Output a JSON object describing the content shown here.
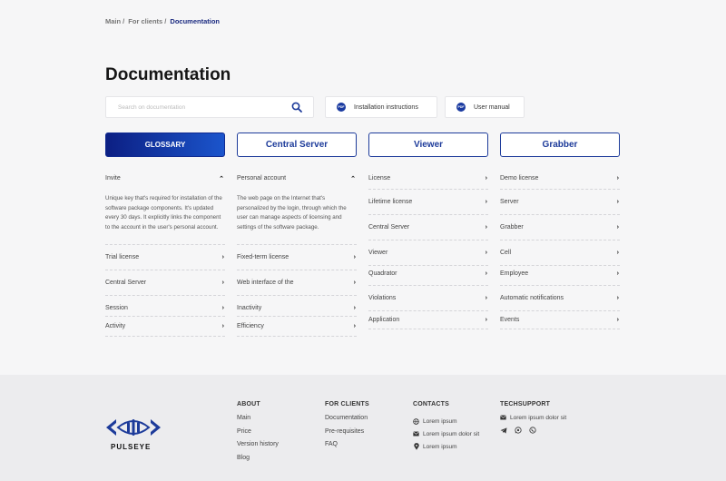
{
  "breadcrumb": {
    "items": [
      "Main",
      "For clients"
    ],
    "separator": "/",
    "current": "Documentation"
  },
  "page_title": "Documentation",
  "search": {
    "placeholder": "Search on documentation",
    "icon": "search-icon"
  },
  "doc_buttons": [
    {
      "badge": "PDF",
      "label": "Installation instructions"
    },
    {
      "badge": "PDF",
      "label": "User manual"
    }
  ],
  "tabs": [
    {
      "label": "GLOSSARY",
      "active": true
    },
    {
      "label": "Central Server",
      "active": false
    },
    {
      "label": "Viewer",
      "active": false
    },
    {
      "label": "Grabber",
      "active": false
    }
  ],
  "columns": [
    {
      "expanded": {
        "term": "Invite",
        "description": "Unique key that's required for installation of the software package components. It's updated every 30 days. It explicitly links the component to the account in the user's personal account."
      },
      "items": [
        "Trial license",
        "Central Server",
        "Session",
        "Activity"
      ]
    },
    {
      "expanded": {
        "term": "Personal account",
        "description": "The web page on the Internet that's personalized by the login, through which the user can manage aspects of licensing and settings of the software package."
      },
      "items": [
        "Fixed-term license",
        "Web interface of the",
        "Inactivity",
        "Efficiency"
      ]
    },
    {
      "items": [
        "License",
        "Lifetime license",
        "Central Server",
        "Viewer",
        "Quadrator",
        "Violations",
        "Application"
      ]
    },
    {
      "items": [
        "Demo license",
        "Server",
        "Grabber",
        "Cell",
        "Employee",
        "Automatic notifications",
        "Events"
      ]
    }
  ],
  "footer": {
    "logo_text": "PULSEYE",
    "about": {
      "title": "ABOUT",
      "links": [
        "Main",
        "Price",
        "Version history",
        "Blog"
      ]
    },
    "for_clients": {
      "title": "FOR CLIENTS",
      "links": [
        "Documentation",
        "Pre-requisites",
        "FAQ"
      ]
    },
    "contacts": {
      "title": "CONTACTS",
      "rows": [
        {
          "icon": "globe-icon",
          "text": "Lorem ipsum"
        },
        {
          "icon": "mail-icon",
          "text": "Lorem ipsum dolor sit"
        },
        {
          "icon": "location-pin-icon",
          "text": "Lorem ipsum"
        }
      ]
    },
    "techsupport": {
      "title": "TECHSUPPORT",
      "rows": [
        {
          "icon": "mail-icon",
          "text": "Lorem ipsum dolor sit"
        }
      ],
      "social_icons": [
        "telegram-icon",
        "whatsapp-icon",
        "viber-icon"
      ]
    }
  },
  "colors": {
    "brand": "#1d3b9a",
    "active_gradient_start": "#0c1f83",
    "active_gradient_end": "#1b55cc",
    "background": "#f6f6f7",
    "footer_bg": "#ececee"
  }
}
